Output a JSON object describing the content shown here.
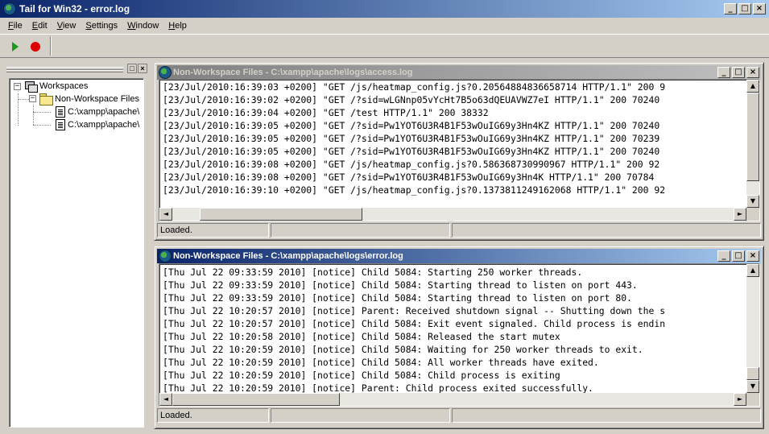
{
  "window": {
    "title": "Tail for Win32 - error.log"
  },
  "caption_buttons": {
    "minimize": "_",
    "maximize": "□",
    "close": "×"
  },
  "menu": [
    {
      "accel": "F",
      "rest": "ile"
    },
    {
      "accel": "E",
      "rest": "dit"
    },
    {
      "accel": "V",
      "rest": "iew"
    },
    {
      "accel": "S",
      "rest": "ettings"
    },
    {
      "accel": "W",
      "rest": "indow"
    },
    {
      "accel": "H",
      "rest": "elp"
    }
  ],
  "toolbar": {
    "start_icon": "play-icon",
    "stop_icon": "stop-icon"
  },
  "tree": {
    "root": "Workspaces",
    "folder": "Non-Workspace Files",
    "files": [
      "C:\\xampp\\apache\\",
      "C:\\xampp\\apache\\"
    ],
    "expander_expanded": "−"
  },
  "access_window": {
    "title": "Non-Workspace Files - C:\\xampp\\apache\\logs\\access.log",
    "lines": [
      "[23/Jul/2010:16:39:03 +0200] \"GET /js/heatmap_config.js?0.20564884836658714 HTTP/1.1\" 200 9",
      "[23/Jul/2010:16:39:02 +0200] \"GET /?sid=wLGNnp05vYcHt7B5o63dQEUAVWZ7eI HTTP/1.1\" 200 70240",
      "[23/Jul/2010:16:39:04 +0200] \"GET /test HTTP/1.1\" 200 38332",
      "[23/Jul/2010:16:39:05 +0200] \"GET /?sid=Pw1YOT6U3R4B1F53wOuIG69y3Hn4KZ HTTP/1.1\" 200 70240",
      "[23/Jul/2010:16:39:05 +0200] \"GET /?sid=Pw1YOT6U3R4B1F53wOuIG69y3Hn4KZ HTTP/1.1\" 200 70239",
      "[23/Jul/2010:16:39:05 +0200] \"GET /?sid=Pw1YOT6U3R4B1F53wOuIG69y3Hn4KZ HTTP/1.1\" 200 70240",
      "[23/Jul/2010:16:39:08 +0200] \"GET /js/heatmap_config.js?0.586368730990967 HTTP/1.1\" 200 92",
      "[23/Jul/2010:16:39:08 +0200] \"GET /?sid=Pw1YOT6U3R4B1F53wOuIG69y3Hn4K HTTP/1.1\" 200 70784",
      "[23/Jul/2010:16:39:10 +0200] \"GET /js/heatmap_config.js?0.1373811249162068 HTTP/1.1\" 200 92"
    ],
    "status": "Loaded."
  },
  "error_window": {
    "title": "Non-Workspace Files - C:\\xampp\\apache\\logs\\error.log",
    "lines": [
      "[Thu Jul 22 09:33:59 2010] [notice] Child 5084: Starting 250 worker threads.",
      "[Thu Jul 22 09:33:59 2010] [notice] Child 5084: Starting thread to listen on port 443.",
      "[Thu Jul 22 09:33:59 2010] [notice] Child 5084: Starting thread to listen on port 80.",
      "[Thu Jul 22 10:20:57 2010] [notice] Parent: Received shutdown signal -- Shutting down the s",
      "[Thu Jul 22 10:20:57 2010] [notice] Child 5084: Exit event signaled. Child process is endin",
      "[Thu Jul 22 10:20:58 2010] [notice] Child 5084: Released the start mutex",
      "[Thu Jul 22 10:20:59 2010] [notice] Child 5084: Waiting for 250 worker threads to exit.",
      "[Thu Jul 22 10:20:59 2010] [notice] Child 5084: All worker threads have exited.",
      "[Thu Jul 22 10:20:59 2010] [notice] Child 5084: Child process is exiting",
      "[Thu Jul 22 10:20:59 2010] [notice] Parent: Child process exited successfully."
    ],
    "status": "Loaded."
  },
  "scroll_arrows": {
    "up": "▲",
    "down": "▼",
    "left": "◄",
    "right": "►"
  }
}
